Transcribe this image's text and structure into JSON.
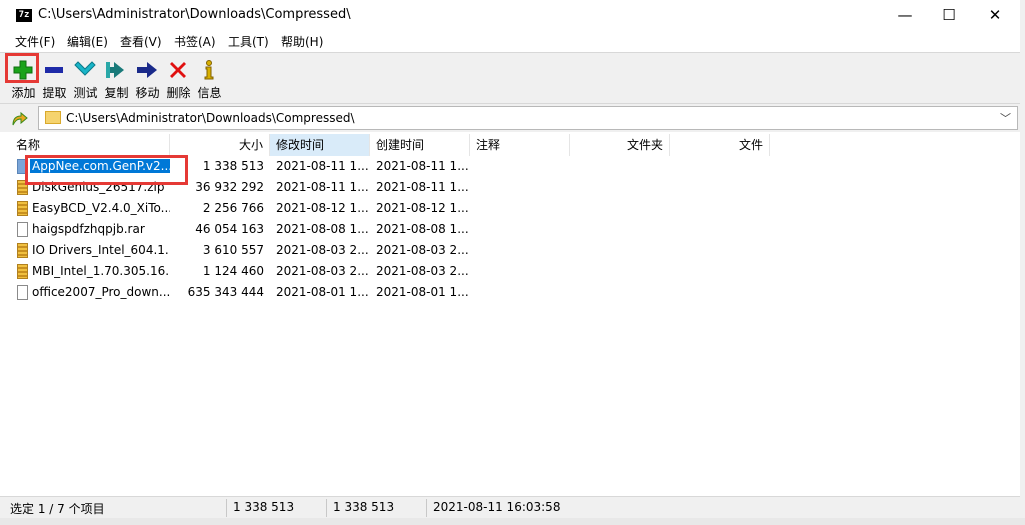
{
  "titlebar": {
    "app_icon": "7z",
    "title": "C:\\Users\\Administrator\\Downloads\\Compressed\\",
    "min_glyph": "—",
    "max_glyph": "☐",
    "close_glyph": "✕"
  },
  "menu": [
    "文件(F)",
    "编辑(E)",
    "查看(V)",
    "书签(A)",
    "工具(T)",
    "帮助(H)"
  ],
  "toolbar": [
    {
      "label": "添加",
      "icon": "add-icon",
      "color": "#1aa31a"
    },
    {
      "label": "提取",
      "icon": "extract-icon",
      "color": "#1e2aa8"
    },
    {
      "label": "测试",
      "icon": "test-icon",
      "color": "#19b5c8"
    },
    {
      "label": "复制",
      "icon": "copy-icon",
      "color": "#1a7a7a"
    },
    {
      "label": "移动",
      "icon": "move-icon",
      "color": "#1a2a8a"
    },
    {
      "label": "删除",
      "icon": "delete-icon",
      "color": "#e01010"
    },
    {
      "label": "信息",
      "icon": "info-icon",
      "color": "#d8b000"
    }
  ],
  "address": {
    "path": "C:\\Users\\Administrator\\Downloads\\Compressed\\"
  },
  "columns": [
    "名称",
    "大小",
    "修改时间",
    "创建时间",
    "注释",
    "文件夹",
    "文件"
  ],
  "files": [
    {
      "name": "AppNee.com.GenP.v2...",
      "size": "1 338 513",
      "modified": "2021-08-11 1...",
      "created": "2021-08-11 1...",
      "type": "selected"
    },
    {
      "name": "DiskGenius_26517.zip",
      "size": "36 932 292",
      "modified": "2021-08-11 1...",
      "created": "2021-08-11 1...",
      "type": "zip"
    },
    {
      "name": "EasyBCD_V2.4.0_XiTo...",
      "size": "2 256 766",
      "modified": "2021-08-12 1...",
      "created": "2021-08-12 1...",
      "type": "zip"
    },
    {
      "name": "haigspdfzhqpjb.rar",
      "size": "46 054 163",
      "modified": "2021-08-08 1...",
      "created": "2021-08-08 1...",
      "type": "file"
    },
    {
      "name": "IO Drivers_Intel_604.1...",
      "size": "3 610 557",
      "modified": "2021-08-03 2...",
      "created": "2021-08-03 2...",
      "type": "zip"
    },
    {
      "name": "MBI_Intel_1.70.305.16...",
      "size": "1 124 460",
      "modified": "2021-08-03 2...",
      "created": "2021-08-03 2...",
      "type": "zip"
    },
    {
      "name": "office2007_Pro_down...",
      "size": "635 343 444",
      "modified": "2021-08-01 1...",
      "created": "2021-08-01 1...",
      "type": "file"
    }
  ],
  "status": {
    "selection": "选定 1 / 7 个项目",
    "size": "1 338 513",
    "packed": "1 338 513",
    "date": "2021-08-11 16:03:58"
  },
  "colors": {
    "highlight": "#e53935",
    "selection": "#0078d7",
    "sorted_header": "#d9ebf9"
  }
}
